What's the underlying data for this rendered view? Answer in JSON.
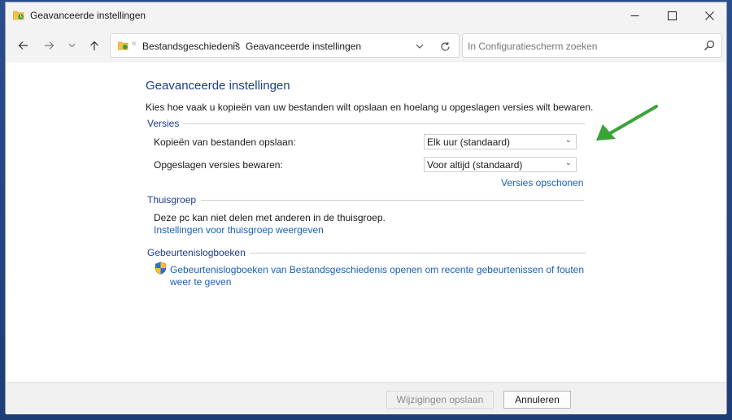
{
  "window": {
    "title": "Geavanceerde instellingen",
    "buttons": {
      "minimize": "—",
      "maximize": "☐",
      "close": "✕"
    }
  },
  "nav": {
    "back_icon": "arrow-left-icon",
    "forward_icon": "arrow-right-icon",
    "recent_icon": "chevron-down-icon",
    "up_icon": "arrow-up-icon"
  },
  "address": {
    "separator": "«",
    "crumbs": [
      "Bestandsgeschiedenis",
      "Geavanceerde instellingen"
    ],
    "crumb_separator": ">"
  },
  "search": {
    "placeholder": "In Configuratiescherm zoeken"
  },
  "main": {
    "heading": "Geavanceerde instellingen",
    "description": "Kies hoe vaak u kopieën van uw bestanden wilt opslaan en hoelang u opgeslagen versies wilt bewaren.",
    "versies": {
      "header": "Versies",
      "copies_label": "Kopieën van bestanden opslaan:",
      "copies_value": "Elk uur (standaard)",
      "keep_label": "Opgeslagen versies bewaren:",
      "keep_value": "Voor altijd (standaard)",
      "cleanup_link": "Versies opschonen"
    },
    "thuisgroep": {
      "header": "Thuisgroep",
      "text": "Deze pc kan niet delen met anderen in de thuisgroep.",
      "link": "Instellingen voor thuisgroep weergeven"
    },
    "logboeken": {
      "header": "Gebeurtenislogboeken",
      "link_line1": "Gebeurtenislogboeken van Bestandsgeschiedenis openen om recente gebeurtenissen of fouten",
      "link_line2": "weer te geven"
    }
  },
  "footer": {
    "save_label": "Wijzigingen opslaan",
    "cancel_label": "Annuleren"
  },
  "colors": {
    "accent_text": "#1e3c8c",
    "link": "#1a5fb4",
    "annotation_arrow": "#3aa436"
  }
}
